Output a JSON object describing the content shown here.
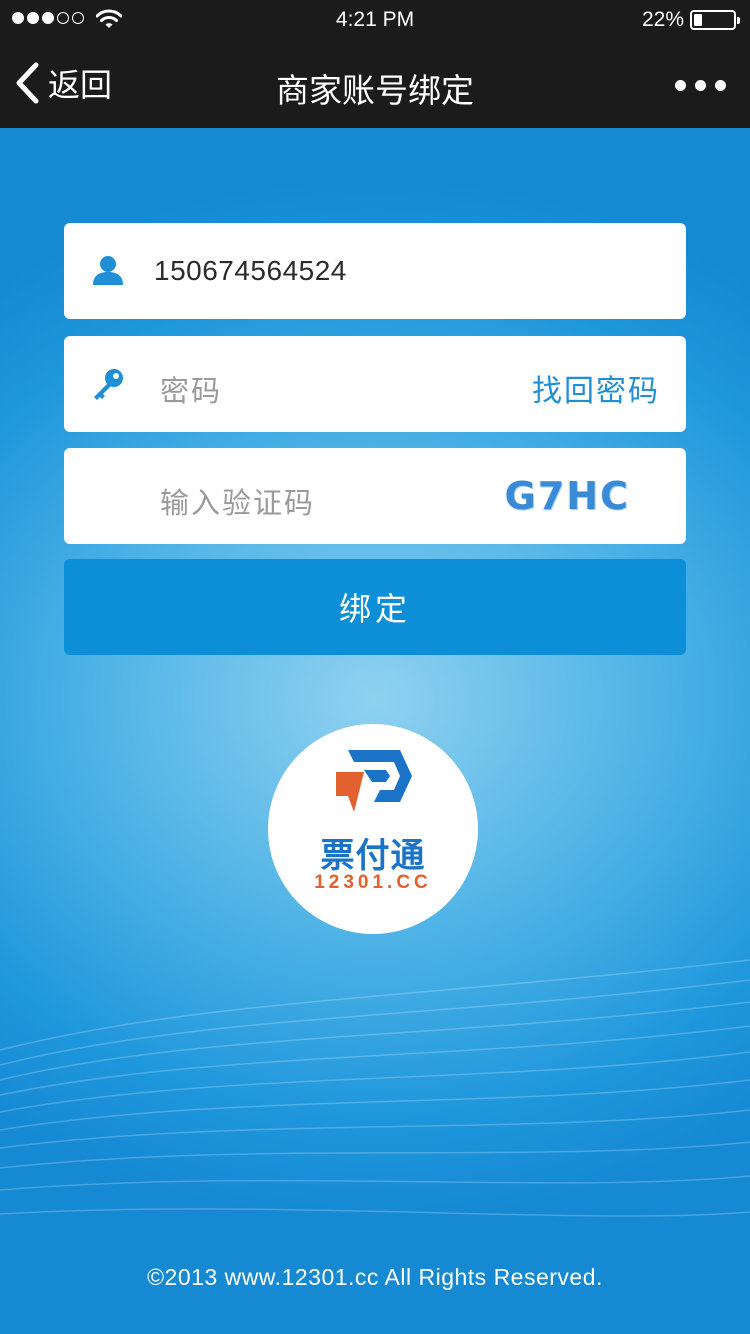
{
  "status_bar": {
    "signal_bars": 3,
    "time": "4:21 PM",
    "battery_percent": "22%",
    "battery_level": 0.22
  },
  "nav": {
    "back_label": "返回",
    "title": "商家账号绑定",
    "more_icon": "more-icon"
  },
  "form": {
    "account": {
      "value": "150674564524",
      "icon": "user-icon"
    },
    "password": {
      "placeholder": "密码",
      "icon": "key-icon",
      "forgot_label": "找回密码"
    },
    "captcha": {
      "placeholder": "输入验证码",
      "code": "G7HC"
    },
    "submit_label": "绑定"
  },
  "logo": {
    "name": "票付通",
    "domain": "12301.CC"
  },
  "footer": "©2013 www.12301.cc All Rights Reserved.",
  "colors": {
    "accent": "#0d8fd8",
    "link": "#1f8fd6",
    "bar": "#1b1b1b",
    "logo_blue": "#1a73c6",
    "logo_orange": "#e3612e"
  }
}
